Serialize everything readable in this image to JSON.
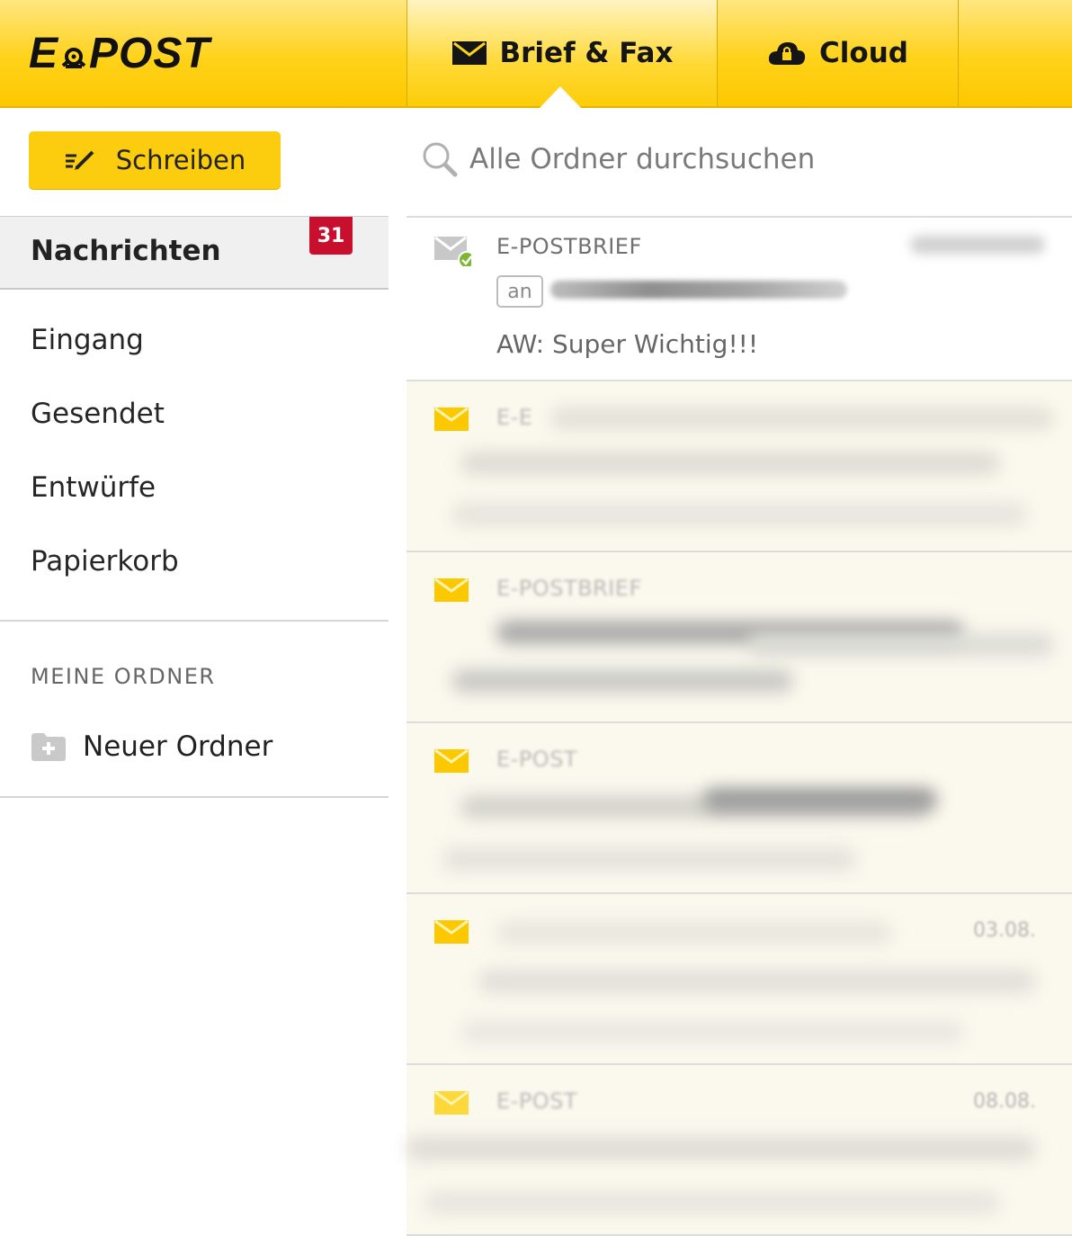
{
  "header": {
    "logo": "E POST",
    "tabs": [
      {
        "label": "Brief & Fax",
        "icon": "envelope-icon",
        "active": true
      },
      {
        "label": "Cloud",
        "icon": "cloud-lock-icon",
        "active": false
      }
    ]
  },
  "sidebar": {
    "write_label": "Schreiben",
    "active_item": {
      "label": "Nachrichten",
      "badge": "31"
    },
    "items": [
      {
        "label": "Eingang"
      },
      {
        "label": "Gesendet"
      },
      {
        "label": "Entwürfe"
      },
      {
        "label": "Papierkorb"
      }
    ],
    "section_title": "MEINE ORDNER",
    "new_folder_label": "Neuer Ordner"
  },
  "main": {
    "search_placeholder": "Alle Ordner durchsuchen",
    "messages": [
      {
        "kind": "E-POSTBRIEF",
        "to_label": "an",
        "subject": "AW: Super Wichtig!!!",
        "status": "read-sent"
      },
      {
        "kind": "E-E",
        "status": "unread"
      },
      {
        "kind": "E-POSTBRIEF",
        "status": "unread"
      },
      {
        "kind": "E-POST",
        "status": "unread"
      },
      {
        "kind": "",
        "date": "03.08.",
        "status": "unread"
      },
      {
        "kind": "E-POST",
        "date": "08.08.",
        "status": "unread"
      }
    ]
  },
  "colors": {
    "brand_yellow": "#fccc0e",
    "badge_red": "#c8102e",
    "check_green": "#7cb82f"
  }
}
